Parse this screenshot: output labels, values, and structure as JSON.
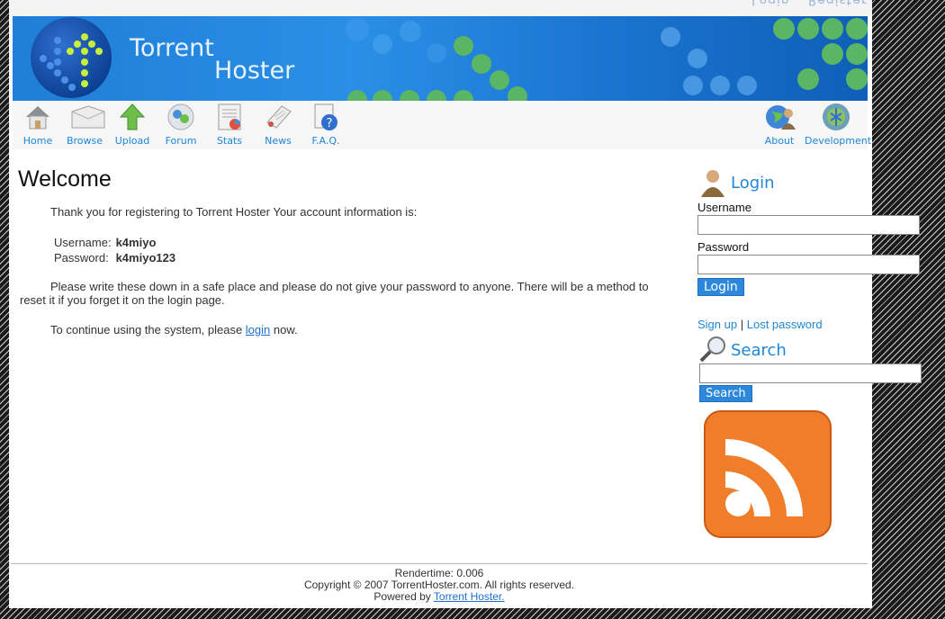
{
  "topstrip": {
    "ghost_text_1": "Login",
    "ghost_text_2": "Register"
  },
  "header": {
    "title_line1": "Torrent",
    "title_line2": "Hoster"
  },
  "nav": {
    "left": [
      {
        "label": "Home",
        "icon": "home-icon"
      },
      {
        "label": "Browse",
        "icon": "browse-icon"
      },
      {
        "label": "Upload",
        "icon": "upload-icon"
      },
      {
        "label": "Forum",
        "icon": "forum-icon"
      },
      {
        "label": "Stats",
        "icon": "stats-icon"
      },
      {
        "label": "News",
        "icon": "news-icon"
      },
      {
        "label": "F.A.Q.",
        "icon": "faq-icon"
      }
    ],
    "right": [
      {
        "label": "About",
        "icon": "about-icon"
      },
      {
        "label": "Development",
        "icon": "development-icon"
      }
    ]
  },
  "main": {
    "heading": "Welcome",
    "intro": "Thank you for registering to Torrent Hoster Your account information is:",
    "username_label": "Username:",
    "username_value": "k4miyo",
    "password_label": "Password:",
    "password_value": "k4miyo123",
    "notice": "Please write these down in a safe place and please do not give your password to anyone. There will be a method to reset it if you forget it on the login page.",
    "continue_prefix": "To continue using the system, please ",
    "continue_link": "login",
    "continue_suffix": " now."
  },
  "sidebar": {
    "login_heading": "Login",
    "username_label": "Username",
    "username_value": "",
    "password_label": "Password",
    "password_value": "",
    "login_button": "Login",
    "signup_link": "Sign up",
    "separator": "|",
    "lost_password_link": "Lost password",
    "search_heading": "Search",
    "search_value": "",
    "search_button": "Search"
  },
  "footer": {
    "rendertime": "Rendertime: 0.006",
    "copyright": "Copyright © 2007 TorrentHoster.com. All rights reserved.",
    "powered_prefix": "Powered by ",
    "powered_link": "Torrent Hoster."
  },
  "colors": {
    "accent": "#1f86d9",
    "button": "#2d87db",
    "rss": "#f07d2a"
  }
}
